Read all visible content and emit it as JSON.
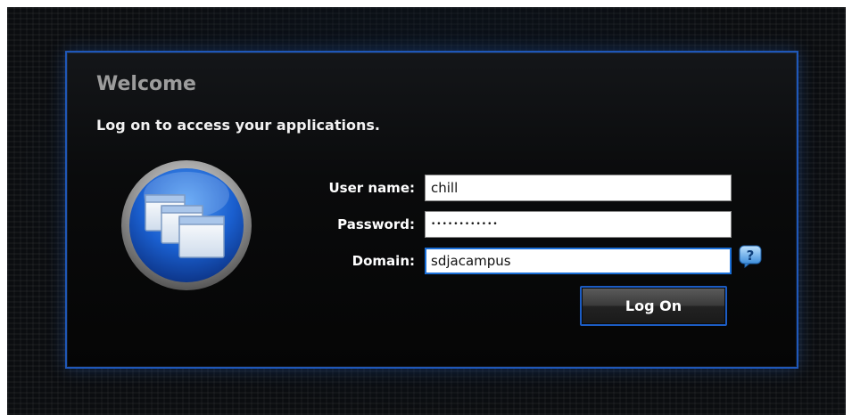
{
  "header": {
    "title": "Welcome",
    "subtitle": "Log on to access your applications."
  },
  "form": {
    "username": {
      "label": "User name:",
      "value": "chill"
    },
    "password": {
      "label": "Password:",
      "value": "••••••••••••"
    },
    "domain": {
      "label": "Domain:",
      "value": "sdjacampus"
    },
    "submit_label": "Log On"
  },
  "icons": {
    "logo": "app-windows-icon",
    "help": "help-icon"
  },
  "colors": {
    "accent": "#1f57b8",
    "background": "#0b0d10",
    "title_gray": "#9c9c9c",
    "text": "#ffffff"
  }
}
